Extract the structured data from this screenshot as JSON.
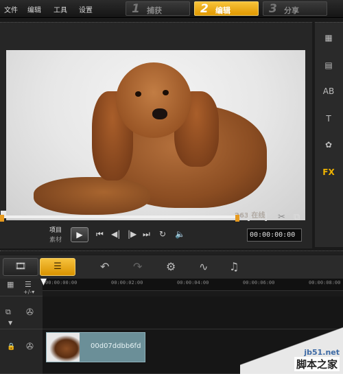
{
  "menu": [
    "文件",
    "编辑",
    "工具",
    "设置"
  ],
  "steps": [
    {
      "num": "1",
      "label": "捕获",
      "active": false
    },
    {
      "num": "2",
      "label": "编辑",
      "active": true
    },
    {
      "num": "3",
      "label": "分享",
      "active": false
    }
  ],
  "preview": {
    "watermark": "263 在线",
    "mode_project": "项目",
    "mode_clip": "素材",
    "timecode": "00:00:00:00"
  },
  "sidebar_icons": [
    "media-icon",
    "transition-icon",
    "title-overlay-icon",
    "text-icon",
    "graphic-icon",
    "fx-filter-icon"
  ],
  "sidebar_fx_label": "FX",
  "timeline": {
    "ruler_ticks": [
      "00:00:00:00",
      "00:00:02:00",
      "00:00:04:00",
      "00:00:06:00",
      "00:00:08:00"
    ],
    "clip_name": "00d07ddbb6fd"
  },
  "watermark": {
    "line1": "jb51.net",
    "line2": "脚本之家"
  },
  "colors": {
    "accent": "#f0b400",
    "clip": "#6b8f98",
    "trim": "#e69a1f"
  }
}
